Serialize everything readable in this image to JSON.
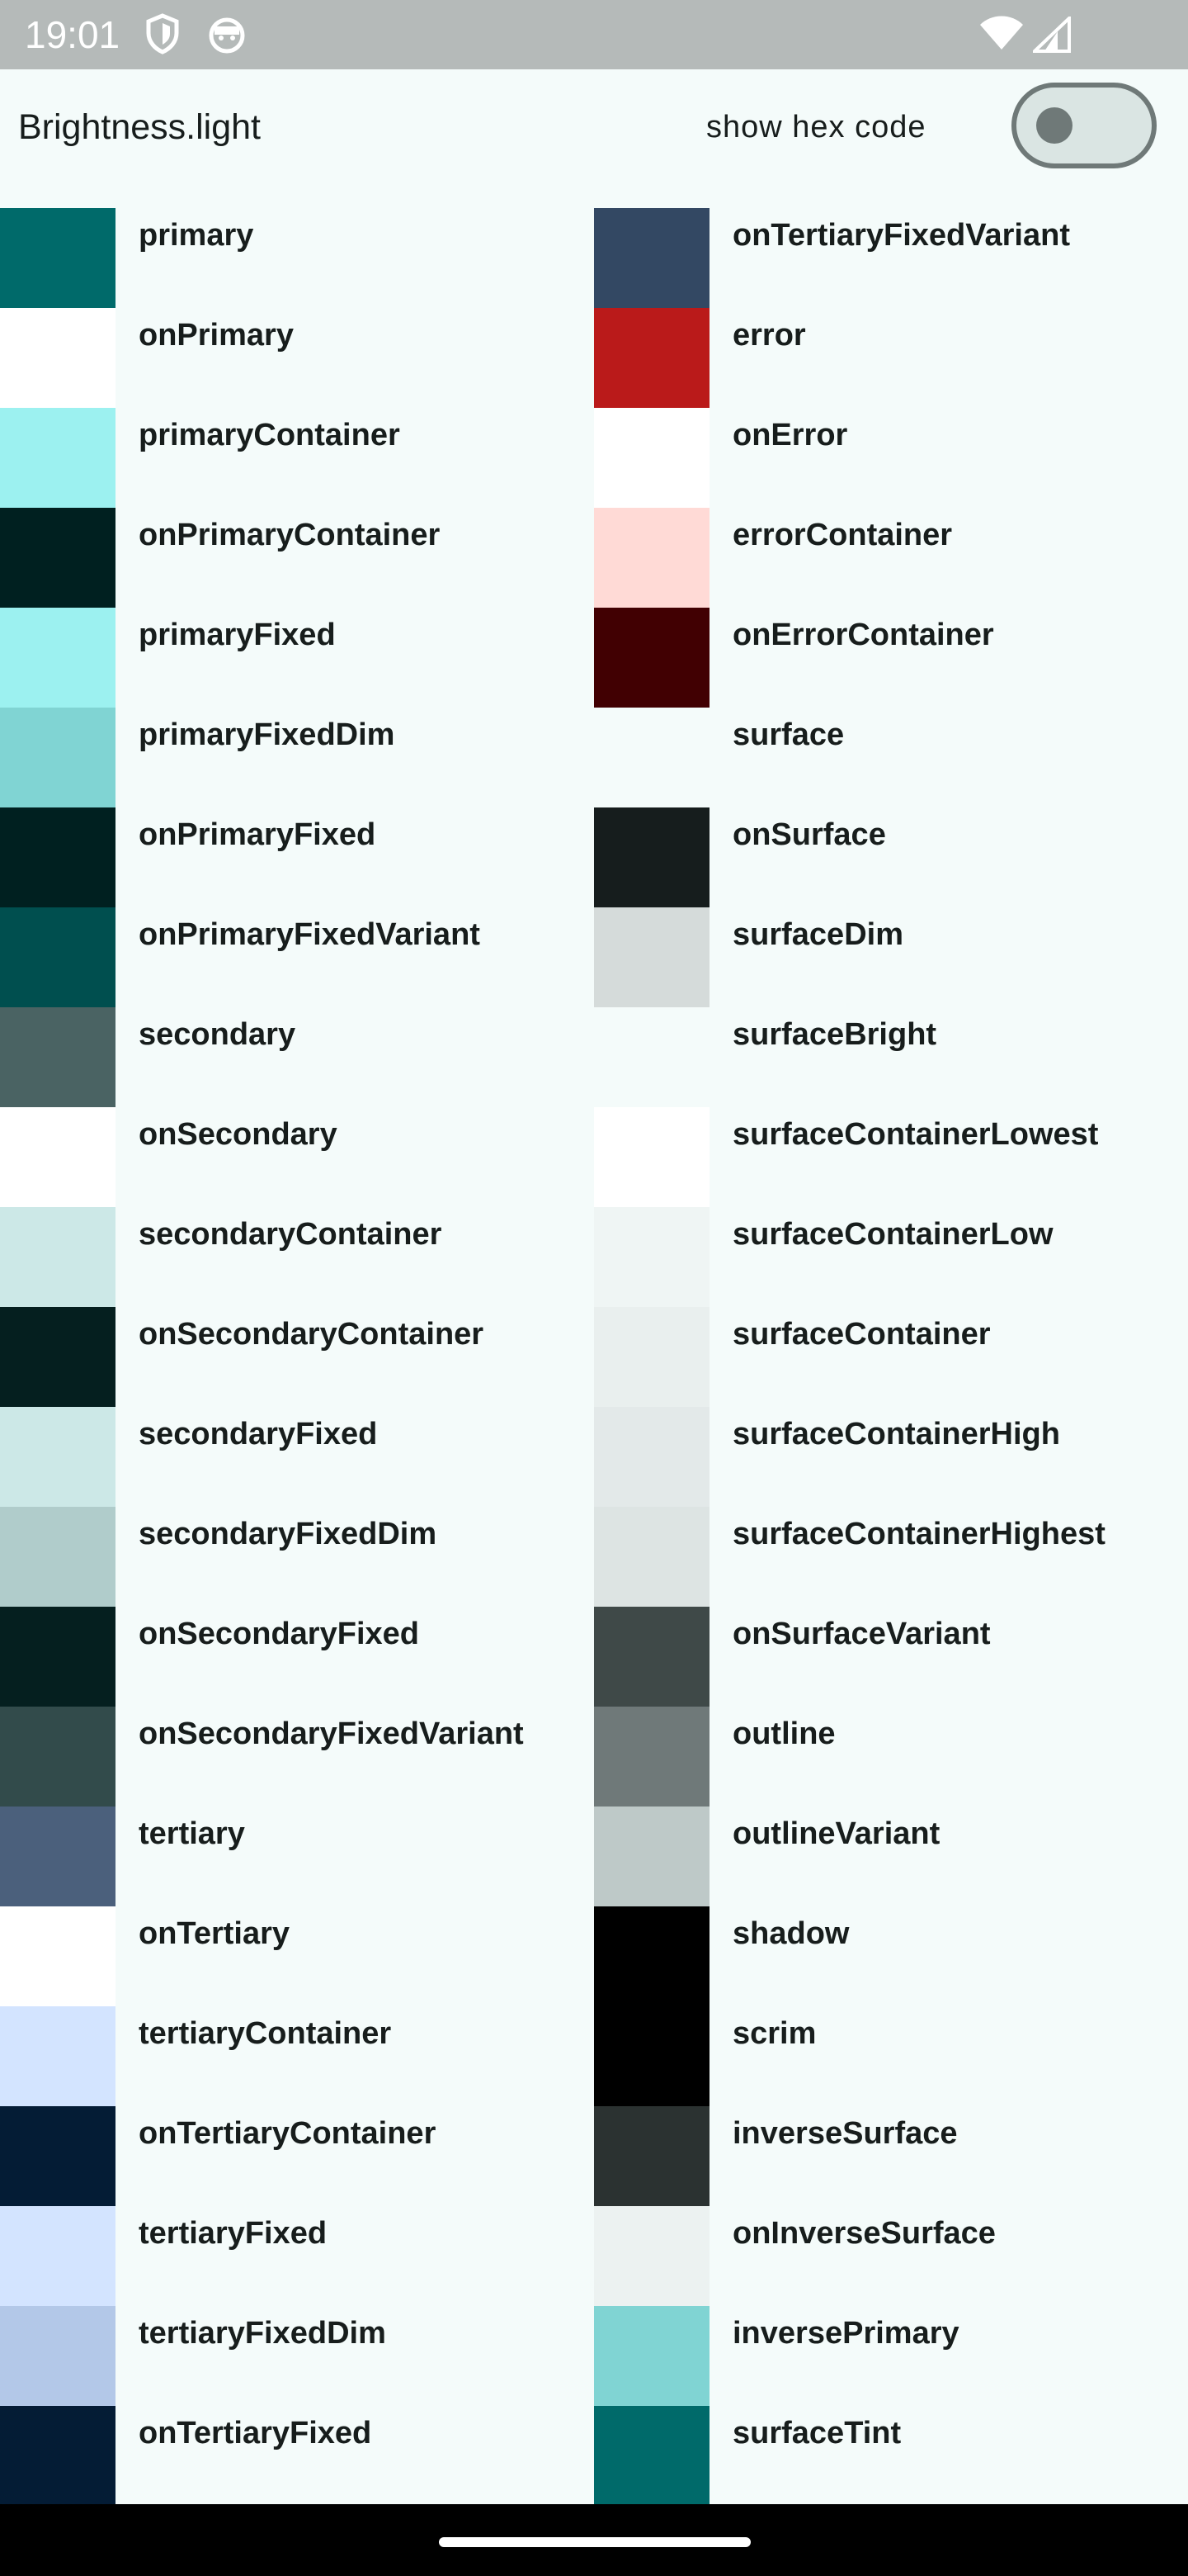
{
  "status_bar": {
    "time": "19:01",
    "icons": [
      "shield-icon",
      "emoji-face-icon",
      "wifi-icon",
      "cellular-signal-icon"
    ]
  },
  "app_bar": {
    "title": "Brightness.light",
    "hex_label": "show hex code",
    "toggle_on": false
  },
  "colors": {
    "left": [
      {
        "name": "primary",
        "color": "#006a6a"
      },
      {
        "name": "onPrimary",
        "color": "#ffffff"
      },
      {
        "name": "primaryContainer",
        "color": "#9cf1f0"
      },
      {
        "name": "onPrimaryContainer",
        "color": "#002020"
      },
      {
        "name": "primaryFixed",
        "color": "#9cf1f0"
      },
      {
        "name": "primaryFixedDim",
        "color": "#80d4d3"
      },
      {
        "name": "onPrimaryFixed",
        "color": "#002020"
      },
      {
        "name": "onPrimaryFixedVariant",
        "color": "#004f4f"
      },
      {
        "name": "secondary",
        "color": "#4a6363"
      },
      {
        "name": "onSecondary",
        "color": "#ffffff"
      },
      {
        "name": "secondaryContainer",
        "color": "#cce8e7"
      },
      {
        "name": "onSecondaryContainer",
        "color": "#051f1f"
      },
      {
        "name": "secondaryFixed",
        "color": "#cce8e7"
      },
      {
        "name": "secondaryFixedDim",
        "color": "#b0cccb"
      },
      {
        "name": "onSecondaryFixed",
        "color": "#051f1f"
      },
      {
        "name": "onSecondaryFixedVariant",
        "color": "#324b4b"
      },
      {
        "name": "tertiary",
        "color": "#4b607c"
      },
      {
        "name": "onTertiary",
        "color": "#ffffff"
      },
      {
        "name": "tertiaryContainer",
        "color": "#d3e4ff"
      },
      {
        "name": "onTertiaryContainer",
        "color": "#041c35"
      },
      {
        "name": "tertiaryFixed",
        "color": "#d3e4ff"
      },
      {
        "name": "tertiaryFixedDim",
        "color": "#b3c8e8"
      },
      {
        "name": "onTertiaryFixed",
        "color": "#041c35"
      }
    ],
    "right": [
      {
        "name": "onTertiaryFixedVariant",
        "color": "#334863"
      },
      {
        "name": "error",
        "color": "#ba1a1a"
      },
      {
        "name": "onError",
        "color": "#ffffff"
      },
      {
        "name": "errorContainer",
        "color": "#ffdad6"
      },
      {
        "name": "onErrorContainer",
        "color": "#410002"
      },
      {
        "name": "surface",
        "color": "#f4fbfa"
      },
      {
        "name": "onSurface",
        "color": "#161d1d"
      },
      {
        "name": "surfaceDim",
        "color": "#d5dbda"
      },
      {
        "name": "surfaceBright",
        "color": "#f4fbfa"
      },
      {
        "name": "surfaceContainerLowest",
        "color": "#ffffff"
      },
      {
        "name": "surfaceContainerLow",
        "color": "#eff5f4"
      },
      {
        "name": "surfaceContainer",
        "color": "#e9efee"
      },
      {
        "name": "surfaceContainerHigh",
        "color": "#e3e9e9"
      },
      {
        "name": "surfaceContainerHighest",
        "color": "#dde4e3"
      },
      {
        "name": "onSurfaceVariant",
        "color": "#3f4948"
      },
      {
        "name": "outline",
        "color": "#6f7979"
      },
      {
        "name": "outlineVariant",
        "color": "#bec9c8"
      },
      {
        "name": "shadow",
        "color": "#000000"
      },
      {
        "name": "scrim",
        "color": "#000000"
      },
      {
        "name": "inverseSurface",
        "color": "#2b3231"
      },
      {
        "name": "onInverseSurface",
        "color": "#ecf2f1"
      },
      {
        "name": "inversePrimary",
        "color": "#80d4d3"
      },
      {
        "name": "surfaceTint",
        "color": "#006a6a"
      }
    ]
  },
  "nav_bar": {
    "handle": "gesture-handle"
  }
}
